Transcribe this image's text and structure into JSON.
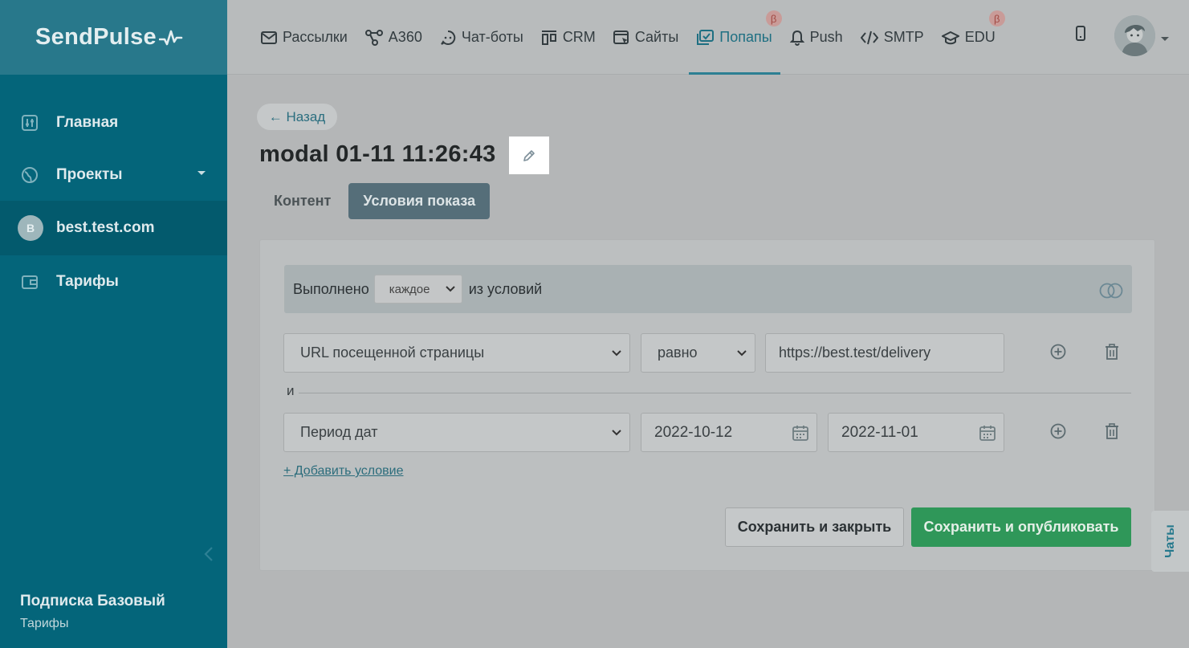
{
  "brand": {
    "logo_text": "SendPulse"
  },
  "sidebar": {
    "items": [
      {
        "label": "Главная",
        "icon": "home-sliders-icon"
      },
      {
        "label": "Проекты",
        "icon": "globe-icon"
      },
      {
        "label": "best.test.com",
        "avatar_letter": "B"
      },
      {
        "label": "Тарифы",
        "icon": "wallet-icon"
      }
    ],
    "plan_title": "Подписка Базовый",
    "plan_link": "Тарифы"
  },
  "topnav": {
    "items": [
      {
        "label": "Рассылки",
        "icon": "envelope-icon"
      },
      {
        "label": "A360",
        "icon": "automation-icon"
      },
      {
        "label": "Чат-боты",
        "icon": "chatbot-icon"
      },
      {
        "label": "CRM",
        "icon": "crm-icon"
      },
      {
        "label": "Сайты",
        "icon": "sites-icon"
      },
      {
        "label": "Попапы",
        "icon": "popups-icon",
        "active": true,
        "beta": "β"
      },
      {
        "label": "Push",
        "icon": "bell-icon"
      },
      {
        "label": "SMTP",
        "icon": "code-icon"
      },
      {
        "label": "EDU",
        "icon": "graduation-cap-icon",
        "beta": "β"
      }
    ]
  },
  "page": {
    "back_label": "← Назад",
    "title": "modal 01-11 11:26:43",
    "tabs": [
      "Контент",
      "Условия показа"
    ],
    "active_tab": "Условия показа"
  },
  "conditions": {
    "header_prefix": "Выполнено",
    "match_mode": "каждое",
    "header_suffix": "из условий",
    "rows": [
      {
        "field": "URL посещенной страницы",
        "operator": "равно",
        "value": "https://best.test/delivery"
      },
      {
        "field": "Период дат",
        "date_from": "2022-10-12",
        "date_to": "2022-11-01"
      }
    ],
    "joiner": "и",
    "add_label": "+ Добавить условие"
  },
  "actions": {
    "save_close": "Сохранить и закрыть",
    "publish": "Сохранить и опубликовать"
  },
  "chats_label": "Чаты",
  "colors": {
    "sidebar": "#04657a",
    "accent": "#2c7f93",
    "publish": "#2f9759"
  }
}
